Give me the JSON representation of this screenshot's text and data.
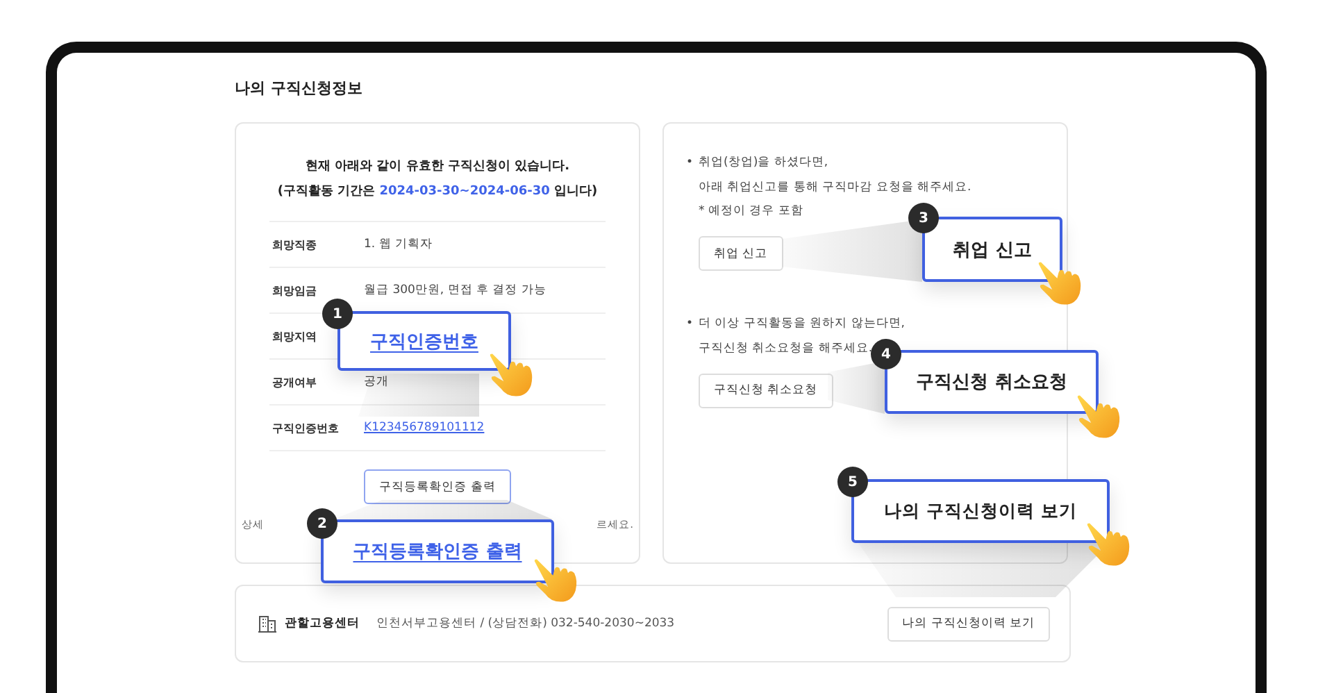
{
  "page_title": "나의 구직신청정보",
  "status": {
    "line_1": "현재 아래와 같이 유효한 구직신청이 있습니다.",
    "prefix": "(구직활동 기간은",
    "period": "2024-03-30~2024-06-30",
    "suffix": "입니다)"
  },
  "details": [
    {
      "label": "희망직종",
      "value": "1. 웹 기획자",
      "kind": "text"
    },
    {
      "label": "희망임금",
      "value": "월급 300만원, 면접 후 결정 가능",
      "kind": "text"
    },
    {
      "label": "희망지역"
    },
    {
      "label": "공개여부",
      "value": "공개",
      "kind": "text"
    },
    {
      "label": "구직인증번호",
      "value": "K123456789101112",
      "kind": "link"
    }
  ],
  "print_button": "구직등록확인증 출력",
  "note": {
    "start": "상세",
    "end": "르세요."
  },
  "sections": [
    {
      "bullet": "•",
      "lines": [
        "취업(창업)을 하셨다면,",
        "아래 취업신고를 통해 구직마감 요청을 해주세요."
      ],
      "footnote": "* 예정이 경우 포함",
      "button": "취업 신고"
    },
    {
      "bullet": "•",
      "lines": [
        "더 이상 구직활동을 원하지 않는다면,",
        "구직신청 취소요청을 해주세요."
      ],
      "button": "구직신청 취소요청"
    }
  ],
  "office": {
    "label": "관할고용센터",
    "info": "인천서부고용센터 / (상담전화) 032-540-2030~2033",
    "button": "나의 구직신청이력 보기"
  },
  "callouts": [
    {
      "number": "1",
      "text": "구직인증번호",
      "kind": "link"
    },
    {
      "number": "2",
      "text": "구직등록확인증 출력",
      "kind": "link"
    },
    {
      "number": "3",
      "text": "취업 신고",
      "kind": "button"
    },
    {
      "number": "4",
      "text": "구직신청 취소요청",
      "kind": "button"
    },
    {
      "number": "5",
      "text": "나의 구직신청이력 보기",
      "kind": "button"
    }
  ]
}
